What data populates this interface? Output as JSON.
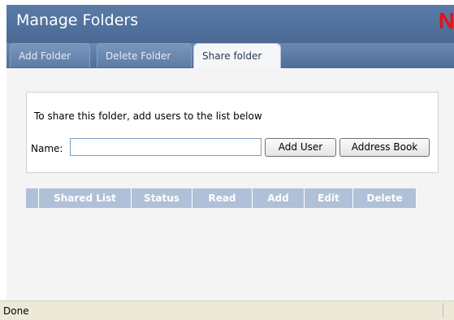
{
  "header": {
    "title": "Manage Folders",
    "logo_text": "N",
    "logo_color": "#e8101a"
  },
  "tabs": [
    {
      "label": "Add Folder",
      "active": false
    },
    {
      "label": "Delete Folder",
      "active": false
    },
    {
      "label": "Share folder",
      "active": true
    }
  ],
  "share": {
    "instruction": "To share this folder, add users to the list below",
    "name_label": "Name:",
    "name_value": "",
    "add_user_label": "Add User",
    "address_book_label": "Address Book"
  },
  "grid": {
    "columns": [
      "Shared List",
      "Status",
      "Read",
      "Add",
      "Edit",
      "Delete"
    ]
  },
  "statusbar": {
    "text": "Done"
  },
  "colors": {
    "header_bg": "#4d6f99",
    "grid_header_bg": "#b0c0d7"
  }
}
